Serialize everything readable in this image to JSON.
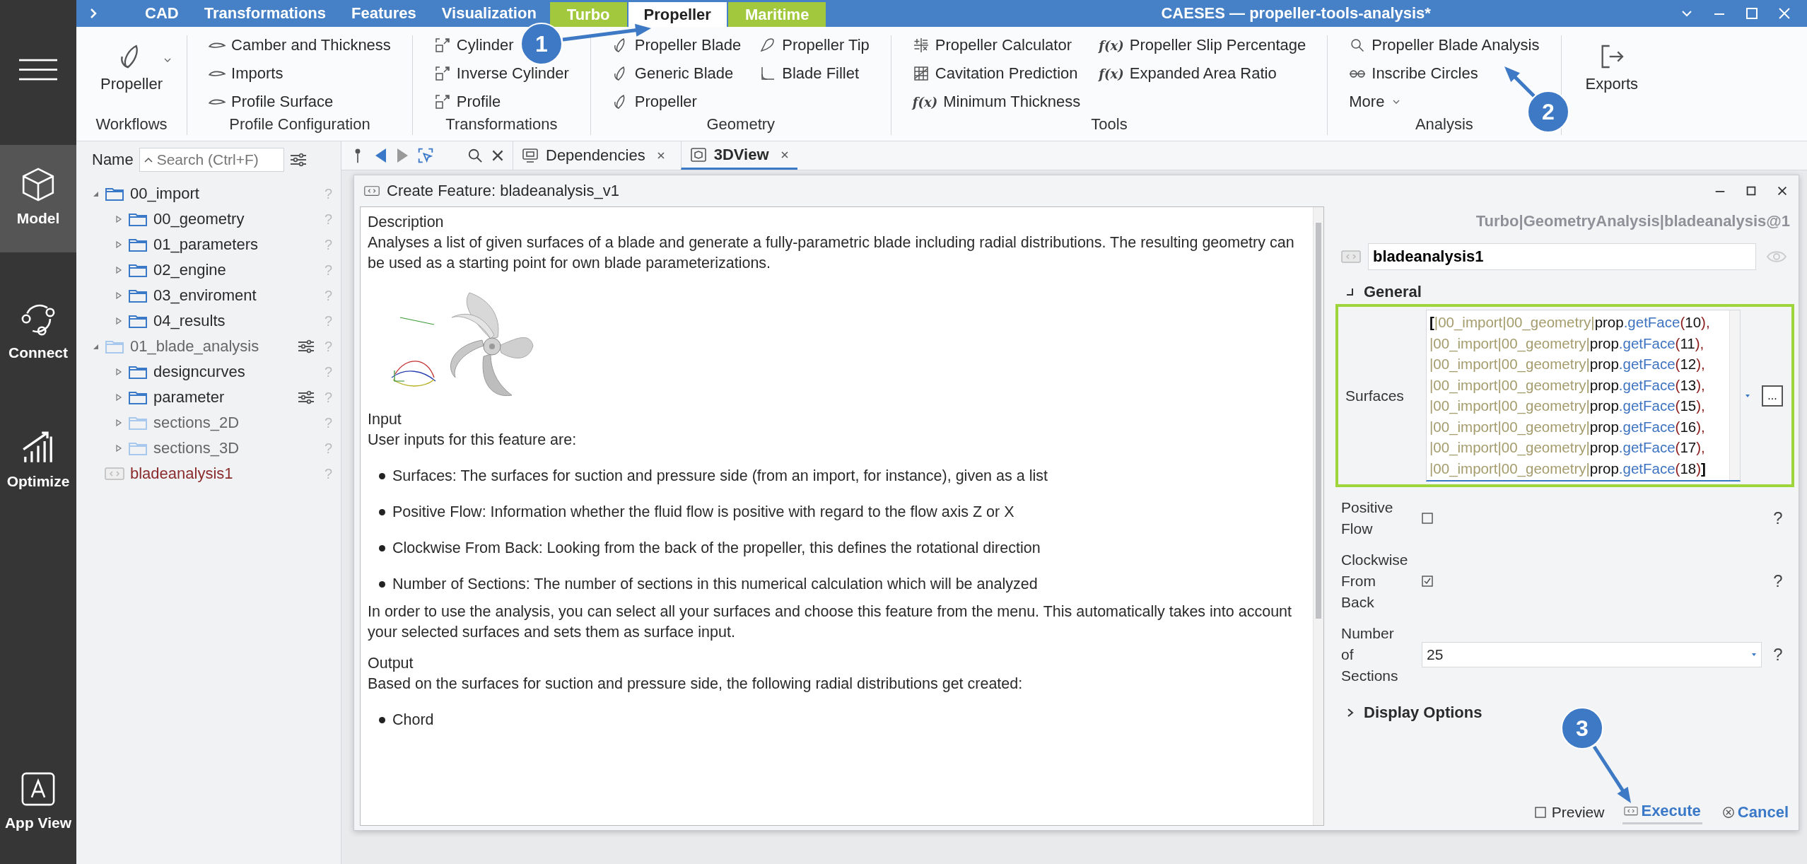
{
  "window": {
    "title": "CAESES — propeller-tools-analysis*"
  },
  "sidebar": {
    "items": [
      {
        "label": "Model",
        "selected": true
      },
      {
        "label": "Connect",
        "selected": false
      },
      {
        "label": "Optimize",
        "selected": false
      },
      {
        "label": "App View",
        "selected": false
      }
    ]
  },
  "ribbon_tabs": [
    {
      "label": "CAD",
      "selected": false,
      "contextual": false
    },
    {
      "label": "Transformations",
      "selected": false,
      "contextual": false
    },
    {
      "label": "Features",
      "selected": false,
      "contextual": false
    },
    {
      "label": "Visualization",
      "selected": false,
      "contextual": false
    },
    {
      "label": "Turbo",
      "selected": false,
      "contextual": true
    },
    {
      "label": "Propeller",
      "selected": true,
      "contextual": false
    },
    {
      "label": "Maritime",
      "selected": false,
      "contextual": true
    }
  ],
  "ribbon": {
    "groups": [
      {
        "label": "Workflows",
        "kind": "large",
        "buttons": [
          {
            "label": "Propeller",
            "dropdown": true
          }
        ]
      },
      {
        "label": "Profile Configuration",
        "kind": "list",
        "columns": [
          [
            {
              "label": "Camber and Thickness",
              "dropdown": false
            },
            {
              "label": "Imports",
              "dropdown": false
            },
            {
              "label": "Profile Surface",
              "dropdown": false
            }
          ]
        ]
      },
      {
        "label": "Transformations",
        "kind": "list",
        "columns": [
          [
            {
              "label": "Cylinder",
              "dropdown": false
            },
            {
              "label": "Inverse Cylinder",
              "dropdown": false
            },
            {
              "label": "Profile",
              "dropdown": false
            }
          ]
        ]
      },
      {
        "label": "Geometry",
        "kind": "list",
        "columns": [
          [
            {
              "label": "Propeller Blade",
              "dropdown": false
            },
            {
              "label": "Generic Blade",
              "dropdown": false
            },
            {
              "label": "Propeller",
              "dropdown": false
            }
          ],
          [
            {
              "label": "Propeller Tip",
              "dropdown": false
            },
            {
              "label": "Blade Fillet",
              "dropdown": false
            }
          ]
        ]
      },
      {
        "label": "Tools",
        "kind": "list",
        "columns": [
          [
            {
              "label": "Propeller Calculator",
              "dropdown": false
            },
            {
              "label": "Cavitation Prediction",
              "dropdown": false
            },
            {
              "label": "Minimum Thickness",
              "prefix": "f(x)",
              "dropdown": false
            }
          ],
          [
            {
              "label": "Propeller Slip Percentage",
              "prefix": "f(x)",
              "dropdown": false
            },
            {
              "label": "Expanded Area Ratio",
              "prefix": "f(x)",
              "dropdown": false
            }
          ]
        ]
      },
      {
        "label": "Analysis",
        "kind": "list",
        "columns": [
          [
            {
              "label": "Propeller Blade Analysis",
              "dropdown": false
            },
            {
              "label": "Inscribe Circles",
              "dropdown": false
            },
            {
              "label": "More",
              "dropdown": true
            }
          ]
        ]
      },
      {
        "kind": "large",
        "buttons": [
          {
            "label": "Exports",
            "dropdown": false
          }
        ]
      }
    ]
  },
  "tree": {
    "header": "Name",
    "search": {
      "placeholder": "Search (Ctrl+F)"
    },
    "items": [
      {
        "label": "00_import",
        "kind": "folder",
        "expanded": true,
        "settings": false,
        "help": "?",
        "children": [
          {
            "label": "00_geometry",
            "kind": "folder",
            "expanded": false,
            "settings": false,
            "help": "?"
          },
          {
            "label": "01_parameters",
            "kind": "folder",
            "expanded": false,
            "settings": false,
            "help": "?"
          },
          {
            "label": "02_engine",
            "kind": "folder",
            "expanded": false,
            "settings": false,
            "help": "?"
          },
          {
            "label": "03_enviroment",
            "kind": "folder",
            "expanded": false,
            "settings": false,
            "help": "?"
          },
          {
            "label": "04_results",
            "kind": "folder",
            "expanded": false,
            "settings": false,
            "help": "?"
          }
        ]
      },
      {
        "label": "01_blade_analysis",
        "kind": "faded-folder",
        "expanded": true,
        "settings": true,
        "help": "?",
        "children": [
          {
            "label": "designcurves",
            "kind": "folder",
            "expanded": false,
            "settings": false,
            "help": "?"
          },
          {
            "label": "parameter",
            "kind": "folder",
            "expanded": false,
            "settings": true,
            "help": "?"
          },
          {
            "label": "sections_2D",
            "kind": "faded-folder",
            "expanded": false,
            "settings": false,
            "help": "?"
          },
          {
            "label": "sections_3D",
            "kind": "faded-folder",
            "expanded": false,
            "settings": false,
            "help": "?"
          }
        ]
      },
      {
        "label": "bladeanalysis1",
        "kind": "feature",
        "settings": false,
        "help": "?"
      }
    ]
  },
  "view_tabs": [
    {
      "label": "Dependencies",
      "selected": false
    },
    {
      "label": "3DView",
      "selected": true
    }
  ],
  "dialog": {
    "title": "Create Feature: bladeanalysis_v1",
    "description": [
      {
        "kind": "heading",
        "text": "Description"
      },
      {
        "kind": "paragraph",
        "text": "Analyses a list of given surfaces of a blade and generate a fully-parametric blade including radial distributions. The resulting geometry can be used as a starting point for own blade parameterizations."
      },
      {
        "kind": "image"
      },
      {
        "kind": "heading",
        "text": "Input"
      },
      {
        "kind": "paragraph",
        "text": "User inputs for this feature are:"
      },
      {
        "kind": "bullet",
        "text": "Surfaces: The surfaces for suction and pressure side (from an import, for instance), given as a list"
      },
      {
        "kind": "bullet",
        "text": "Positive Flow: Information whether the fluid flow is positive with regard to the flow axis Z or X"
      },
      {
        "kind": "bullet",
        "text": "Clockwise From Back: Looking from the back of the propeller, this defines the rotational direction"
      },
      {
        "kind": "bullet",
        "text": "Number of Sections: The number of sections in this numerical calculation which will be analyzed"
      },
      {
        "kind": "paragraph",
        "text": "In order to use the analysis, you can select all your surfaces and choose this feature from the menu. This automatically takes into account your selected surfaces and sets them as surface input."
      },
      {
        "kind": "heading",
        "text": "Output"
      },
      {
        "kind": "paragraph",
        "text": "Based on the surfaces for suction and pressure side, the following radial distributions get created:"
      },
      {
        "kind": "bullet",
        "text": "Chord"
      }
    ],
    "properties": {
      "path": "Turbo|GeometryAnalysis|bladeanalysis@1",
      "name": "bladeanalysis1",
      "section": {
        "label": "General",
        "expanded": true
      },
      "fields": [
        {
          "kind": "code",
          "label": "Surfaces",
          "highlighted": true,
          "button": "...",
          "lines": [
            [
              {
                "text": "[",
                "kind": "bracket"
              },
              {
                "text": "|00_import|00_geometry|",
                "kind": "path"
              },
              {
                "text": "prop",
                "kind": "object"
              },
              {
                "text": ".getFace",
                "kind": "method"
              },
              {
                "text": "(",
                "kind": "paren"
              },
              {
                "text": "10",
                "kind": "number"
              },
              {
                "text": "),",
                "kind": "paren"
              }
            ],
            [
              {
                "text": "|00_import|00_geometry|",
                "kind": "path"
              },
              {
                "text": "prop",
                "kind": "object"
              },
              {
                "text": ".getFace",
                "kind": "method"
              },
              {
                "text": "(",
                "kind": "paren"
              },
              {
                "text": "11",
                "kind": "number"
              },
              {
                "text": "),",
                "kind": "paren"
              }
            ],
            [
              {
                "text": "|00_import|00_geometry|",
                "kind": "path"
              },
              {
                "text": "prop",
                "kind": "object"
              },
              {
                "text": ".getFace",
                "kind": "method"
              },
              {
                "text": "(",
                "kind": "paren"
              },
              {
                "text": "12",
                "kind": "number"
              },
              {
                "text": "),",
                "kind": "paren"
              }
            ],
            [
              {
                "text": "|00_import|00_geometry|",
                "kind": "path"
              },
              {
                "text": "prop",
                "kind": "object"
              },
              {
                "text": ".getFace",
                "kind": "method"
              },
              {
                "text": "(",
                "kind": "paren"
              },
              {
                "text": "13",
                "kind": "number"
              },
              {
                "text": "),",
                "kind": "paren"
              }
            ],
            [
              {
                "text": "|00_import|00_geometry|",
                "kind": "path"
              },
              {
                "text": "prop",
                "kind": "object"
              },
              {
                "text": ".getFace",
                "kind": "method"
              },
              {
                "text": "(",
                "kind": "paren"
              },
              {
                "text": "15",
                "kind": "number"
              },
              {
                "text": "),",
                "kind": "paren"
              }
            ],
            [
              {
                "text": "|00_import|00_geometry|",
                "kind": "path"
              },
              {
                "text": "prop",
                "kind": "object"
              },
              {
                "text": ".getFace",
                "kind": "method"
              },
              {
                "text": "(",
                "kind": "paren"
              },
              {
                "text": "16",
                "kind": "number"
              },
              {
                "text": "),",
                "kind": "paren"
              }
            ],
            [
              {
                "text": "|00_import|00_geometry|",
                "kind": "path"
              },
              {
                "text": "prop",
                "kind": "object"
              },
              {
                "text": ".getFace",
                "kind": "method"
              },
              {
                "text": "(",
                "kind": "paren"
              },
              {
                "text": "17",
                "kind": "number"
              },
              {
                "text": "),",
                "kind": "paren"
              }
            ],
            [
              {
                "text": "|00_import|00_geometry|",
                "kind": "path"
              },
              {
                "text": "prop",
                "kind": "object"
              },
              {
                "text": ".getFace",
                "kind": "method"
              },
              {
                "text": "(",
                "kind": "paren"
              },
              {
                "text": "18",
                "kind": "number"
              },
              {
                "text": ")",
                "kind": "paren"
              },
              {
                "text": "]",
                "kind": "bracket"
              }
            ]
          ]
        },
        {
          "kind": "checkbox",
          "label": "Positive Flow",
          "checked": false,
          "help": "?"
        },
        {
          "kind": "checkbox",
          "label": "Clockwise From Back",
          "checked": true,
          "help": "?"
        },
        {
          "kind": "number",
          "label": "Number of Sections",
          "value": "25",
          "help": "?"
        }
      ],
      "display_options": {
        "label": "Display Options",
        "expanded": false
      }
    },
    "footer": {
      "preview": {
        "label": "Preview",
        "checked": false
      },
      "execute": "Execute",
      "cancel": "Cancel"
    }
  },
  "annotations": [
    {
      "label": "1"
    },
    {
      "label": "2"
    },
    {
      "label": "3"
    }
  ]
}
